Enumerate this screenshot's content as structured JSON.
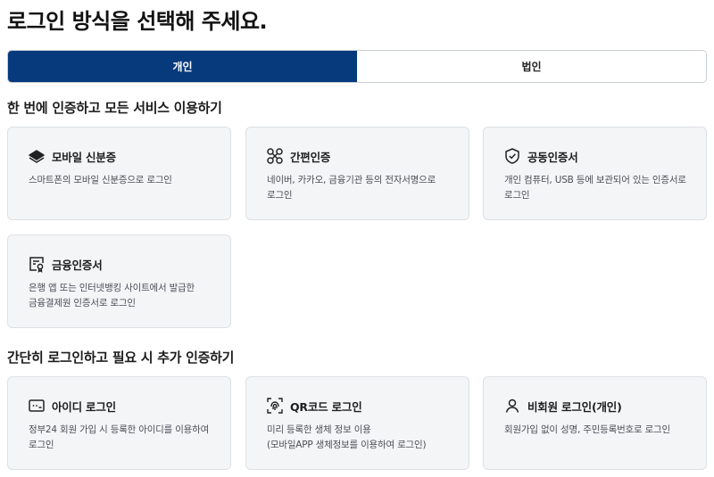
{
  "page_title": "로그인 방식을 선택해 주세요.",
  "tabs": [
    {
      "label": "개인",
      "active": true
    },
    {
      "label": "법인",
      "active": false
    }
  ],
  "sections": [
    {
      "title": "한 번에 인증하고 모든 서비스 이용하기",
      "cards": [
        {
          "icon": "mobile-id-icon",
          "title": "모바일 신분증",
          "desc": [
            "스마트폰의 모바일 신분증으로 로그인"
          ]
        },
        {
          "icon": "simple-auth-icon",
          "title": "간편인증",
          "desc": [
            "네이버, 카카오, 금융기관 등의 전자서명으로",
            "로그인"
          ]
        },
        {
          "icon": "shield-check-icon",
          "title": "공동인증서",
          "desc": [
            "개인 컴퓨터, USB 등에 보관되어 있는 인증서로",
            "로그인"
          ]
        },
        {
          "icon": "certificate-icon",
          "title": "금융인증서",
          "desc": [
            "은행 앱 또는 인터넷뱅킹 사이트에서 발급한",
            "금융결제원 인증서로 로그인"
          ]
        }
      ]
    },
    {
      "title": "간단히 로그인하고 필요 시 추가 인증하기",
      "cards": [
        {
          "icon": "id-password-icon",
          "title": "아이디 로그인",
          "desc": [
            "정부24 회원 가입 시 등록한 아이디를 이용하여",
            "로그인"
          ]
        },
        {
          "icon": "qr-fingerprint-icon",
          "title": "QR코드 로그인",
          "desc": [
            "미리 등록한 생체 정보 이용",
            "(모바일APP 생체정보를 이용하여 로그인)"
          ]
        },
        {
          "icon": "person-icon",
          "title": "비회원 로그인(개인)",
          "desc": [
            "회원가입 없이 성명, 주민등록번호로 로그인"
          ]
        }
      ]
    }
  ],
  "colors": {
    "accent": "#063a7d",
    "card_bg": "#f4f5f7",
    "card_border": "#dde0e5"
  }
}
